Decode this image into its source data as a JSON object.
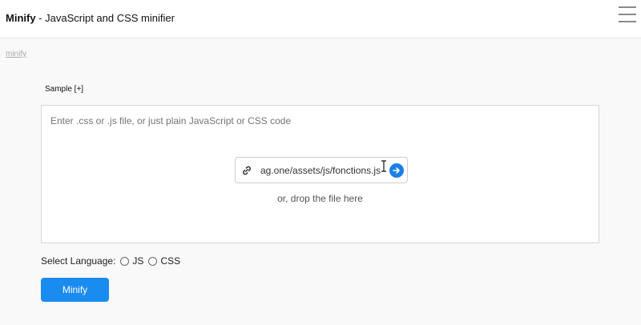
{
  "header": {
    "brand": "Minify",
    "subtitle": " - JavaScript and CSS minifier",
    "menu_icon": "hamburger-menu-icon"
  },
  "breadcrumb": {
    "label": "minify"
  },
  "sample_toggle": {
    "label": "Sample [+]"
  },
  "editor": {
    "placeholder": "Enter .css or .js file, or just plain JavaScript or CSS code",
    "url_input": {
      "value": "ag.one/assets/js/fonctions.js",
      "icon": "link-icon"
    },
    "go_button_icon": "arrow-right-icon",
    "drop_text": "or, drop the file here"
  },
  "language": {
    "label": "Select Language:",
    "options": [
      "JS",
      "CSS"
    ],
    "selected": null
  },
  "actions": {
    "minify_label": "Minify"
  },
  "colors": {
    "accent": "#1a8cf0",
    "go_button": "#1a7fe6"
  }
}
